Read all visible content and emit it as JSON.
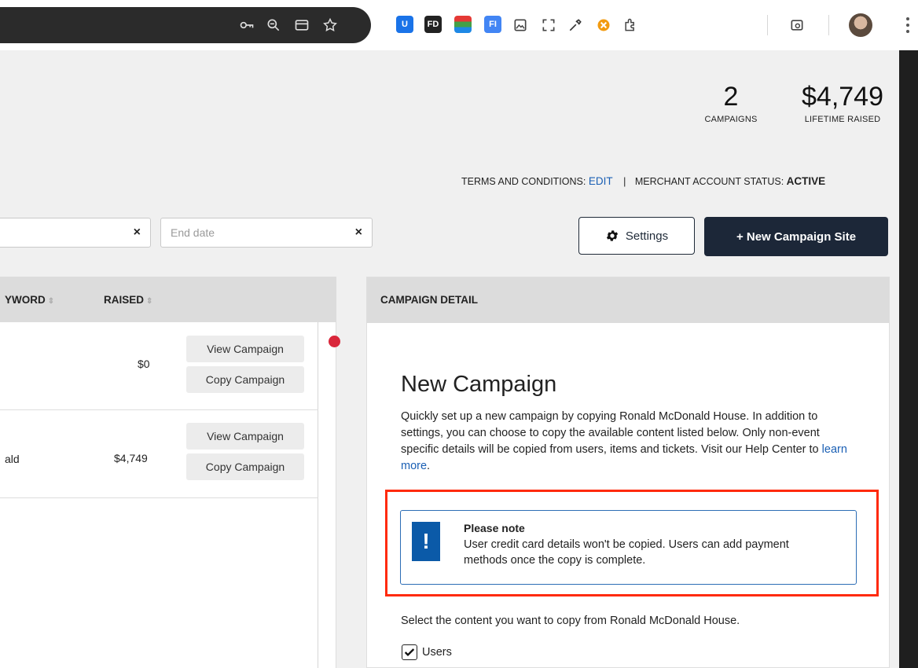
{
  "browser": {
    "extensions": [
      {
        "icon": "key-icon"
      },
      {
        "icon": "zoom-icon"
      },
      {
        "icon": "card-icon"
      },
      {
        "icon": "star-icon"
      },
      {
        "label": "U",
        "color": "#1a73e8"
      },
      {
        "label": "FD",
        "color": "#222222"
      },
      {
        "label": "",
        "color": "#3367d6"
      },
      {
        "label": "FI",
        "color": "#4285f4"
      }
    ]
  },
  "stats": {
    "campaigns_value": "2",
    "campaigns_label": "CAMPAIGNS",
    "raised_value": "$4,749",
    "raised_label": "LIFETIME RAISED"
  },
  "terms": {
    "terms_label": "TERMS AND CONDITIONS:",
    "terms_link": "EDIT",
    "divider": "|",
    "merchant_label": "MERCHANT ACCOUNT STATUS:",
    "merchant_value": "ACTIVE"
  },
  "filters": {
    "start_clear": "×",
    "end_placeholder": "End date",
    "end_clear": "×"
  },
  "actions": {
    "settings_label": "Settings",
    "new_campaign_label": "+ New Campaign Site"
  },
  "table": {
    "headers": {
      "keyword": "YWORD",
      "raised": "RAISED",
      "sort_glyph": "⇕"
    },
    "rows": [
      {
        "name": "",
        "raised": "$0",
        "view_label": "View Campaign",
        "copy_label": "Copy Campaign"
      },
      {
        "name": "ald",
        "raised": "$4,749",
        "view_label": "View Campaign",
        "copy_label": "Copy Campaign"
      }
    ]
  },
  "detail": {
    "header": "CAMPAIGN DETAIL",
    "title": "New Campaign",
    "description": "Quickly set up a new campaign by copying Ronald McDonald House. In addition to settings, you can choose to copy the available content listed below. Only non-event specific details will be copied from users, items and tickets. Visit our Help Center to ",
    "learn_more": "learn more",
    "period": ".",
    "note_icon": "!",
    "note_title": "Please note",
    "note_text": "User credit card details won't be copied. Users can add payment methods once the copy is complete.",
    "select_text": "Select the content you want to copy from Ronald McDonald House.",
    "users_label": "Users",
    "users_checked": true,
    "highlight_color": "#ff2a0c"
  }
}
